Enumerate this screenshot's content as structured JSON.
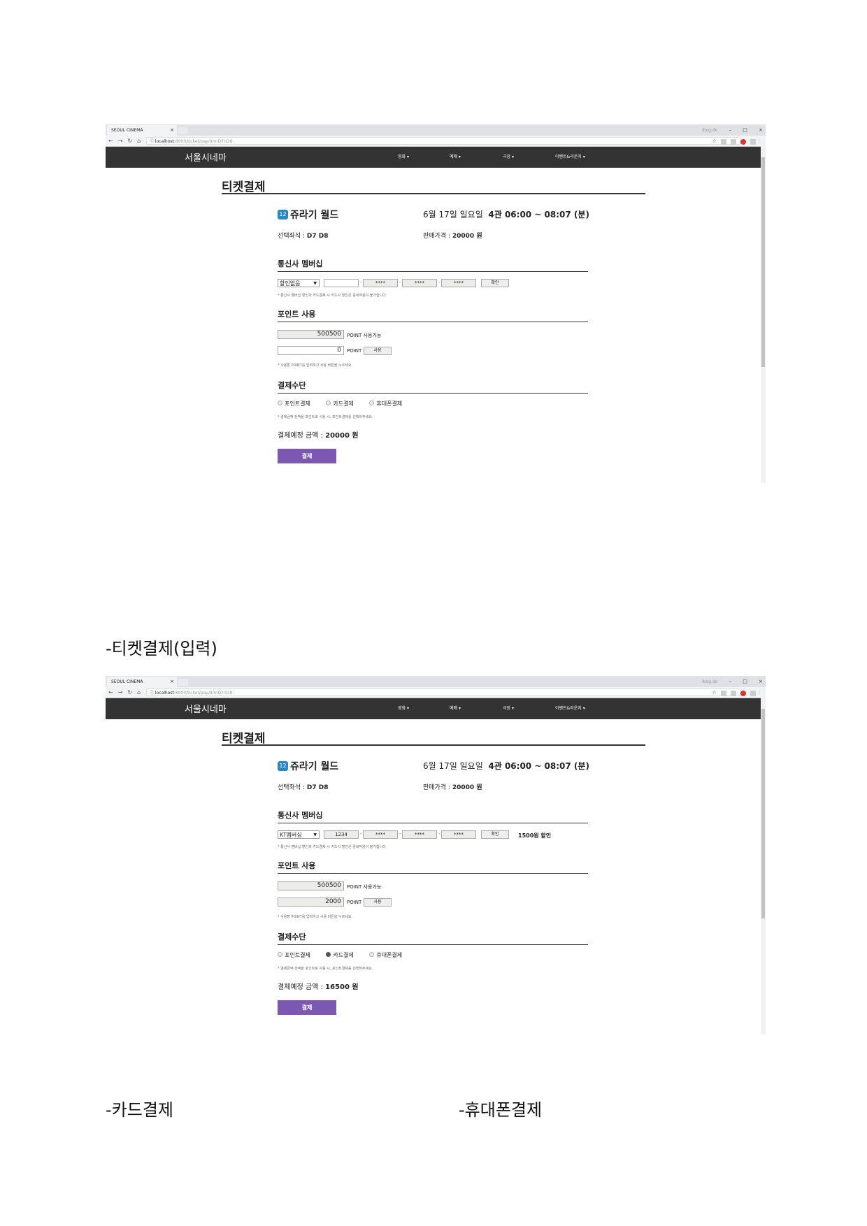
{
  "browser": {
    "tab_title": "SEOUL CINEMA",
    "tab_close": "×",
    "url_host": "localhost",
    "url_path": ":8000/ticket/pay/9/mD7nD8",
    "user_chip": "ibog.do",
    "minimize": "–",
    "maximize": "□",
    "close": "×"
  },
  "site": {
    "brand": "서울시네마",
    "menu": [
      "영화 ▾",
      "예매 ▾",
      "극장 ▾",
      "이벤트&라운지 ▾"
    ]
  },
  "screens": [
    {
      "page_title": "티켓결제",
      "rating": "12",
      "movie_title": "쥬라기 월드",
      "show_date": "6월 17일 일요일",
      "show_hall_time": "4관 06:00 ~ 08:07 (분)",
      "seat_label": "선택좌석 : ",
      "seat_value": "D7 D8",
      "price_label": "판매가격 : ",
      "price_value": "20000 원",
      "membership_title": "통신사 멤버십",
      "membership_select": "할인없음",
      "card_fields": [
        "",
        "****",
        "****",
        "****"
      ],
      "confirm_button": "확인",
      "discount_text": "",
      "membership_note": "* 통신사 멤버십 할인과 카드결제 시 카드사 할인은 중복적용이 불가합니다.",
      "point_title": "포인트 사용",
      "points_available": "500500",
      "points_available_label": "POINT 사용가능",
      "points_use": "0",
      "points_use_label": "POINT",
      "use_button": "사용",
      "point_note": "* 사용할 POINT를 입력하고 사용 버튼을 누르세요.",
      "payment_title": "결제수단",
      "payment_methods": [
        "포인트결제",
        "카드결제",
        "휴대폰결제"
      ],
      "selected_method": -1,
      "payment_note": "* 결제금액 전액을 포인트로 사용 시, 포인트결제를 선택하주세요.",
      "total_label": "결제예정 금액 : ",
      "total_value": "20000 원",
      "pay_button": "결제"
    },
    {
      "page_title": "티켓결제",
      "rating": "12",
      "movie_title": "쥬라기 월드",
      "show_date": "6월 17일 일요일",
      "show_hall_time": "4관 06:00 ~ 08:07 (분)",
      "seat_label": "선택좌석 : ",
      "seat_value": "D7 D8",
      "price_label": "판매가격 : ",
      "price_value": "20000 원",
      "membership_title": "통신사 멤버십",
      "membership_select": "KT멤버십",
      "card_fields": [
        "1234",
        "****",
        "****",
        "****"
      ],
      "confirm_button": "확인",
      "discount_text": "1500원 할인",
      "membership_note": "* 통신사 멤버십 할인과 카드결제 시 카드사 할인은 중복적용이 불가합니다.",
      "point_title": "포인트 사용",
      "points_available": "500500",
      "points_available_label": "POINT 사용가능",
      "points_use": "2000",
      "points_use_label": "POINT",
      "use_button": "사용",
      "point_note": "* 사용할 POINT를 입력하고 사용 버튼을 누르세요.",
      "payment_title": "결제수단",
      "payment_methods": [
        "포인트결제",
        "카드결제",
        "휴대폰결제"
      ],
      "selected_method": 1,
      "payment_note": "* 결제금액 전액을 포인트로 사용 시, 포인트결제를 선택하주세요.",
      "total_label": "결제예정 금액 : ",
      "total_value": "16500 원",
      "pay_button": "결제"
    }
  ],
  "captions": {
    "input": "-티켓결제(입력)",
    "card": "-카드결제",
    "phone": "-휴대폰결제"
  }
}
